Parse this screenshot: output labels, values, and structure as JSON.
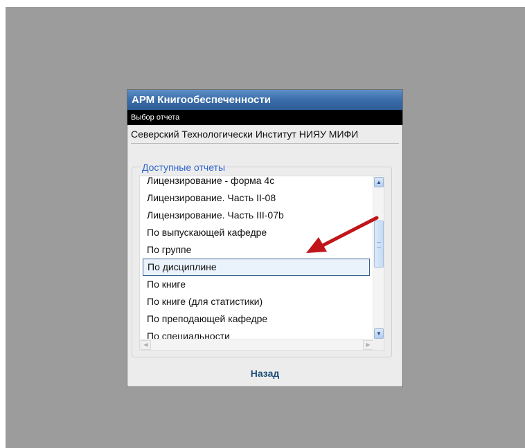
{
  "window": {
    "title": "АРМ Книгообеспеченности",
    "subtitle": "Выбор отчета",
    "organization": "Северский Технологически Институт НИЯУ МИФИ"
  },
  "reports": {
    "legend": "Доступные отчеты",
    "items": [
      "Лицензирование - форма 4с",
      "Лицензирование. Часть II-08",
      "Лицензирование. Часть III-07b",
      "По выпускающей кафедре",
      "По группе",
      "По дисциплине",
      "По книге",
      "По книге (для статистики)",
      "По преподающей кафедре",
      "По специальности"
    ],
    "selected_index": 5
  },
  "footer": {
    "back_label": "Назад"
  },
  "colors": {
    "title_bar": "#3a6da9",
    "legend_text": "#3366cc",
    "back_link": "#1f4e79",
    "annotation_arrow": "#c0161b",
    "backdrop": "#9c9c9c"
  },
  "icons": {
    "scroll_up": "chevron-up-icon",
    "scroll_down": "chevron-down-icon",
    "scroll_left": "chevron-left-icon",
    "scroll_right": "chevron-right-icon",
    "annotation": "red-arrow-icon"
  }
}
